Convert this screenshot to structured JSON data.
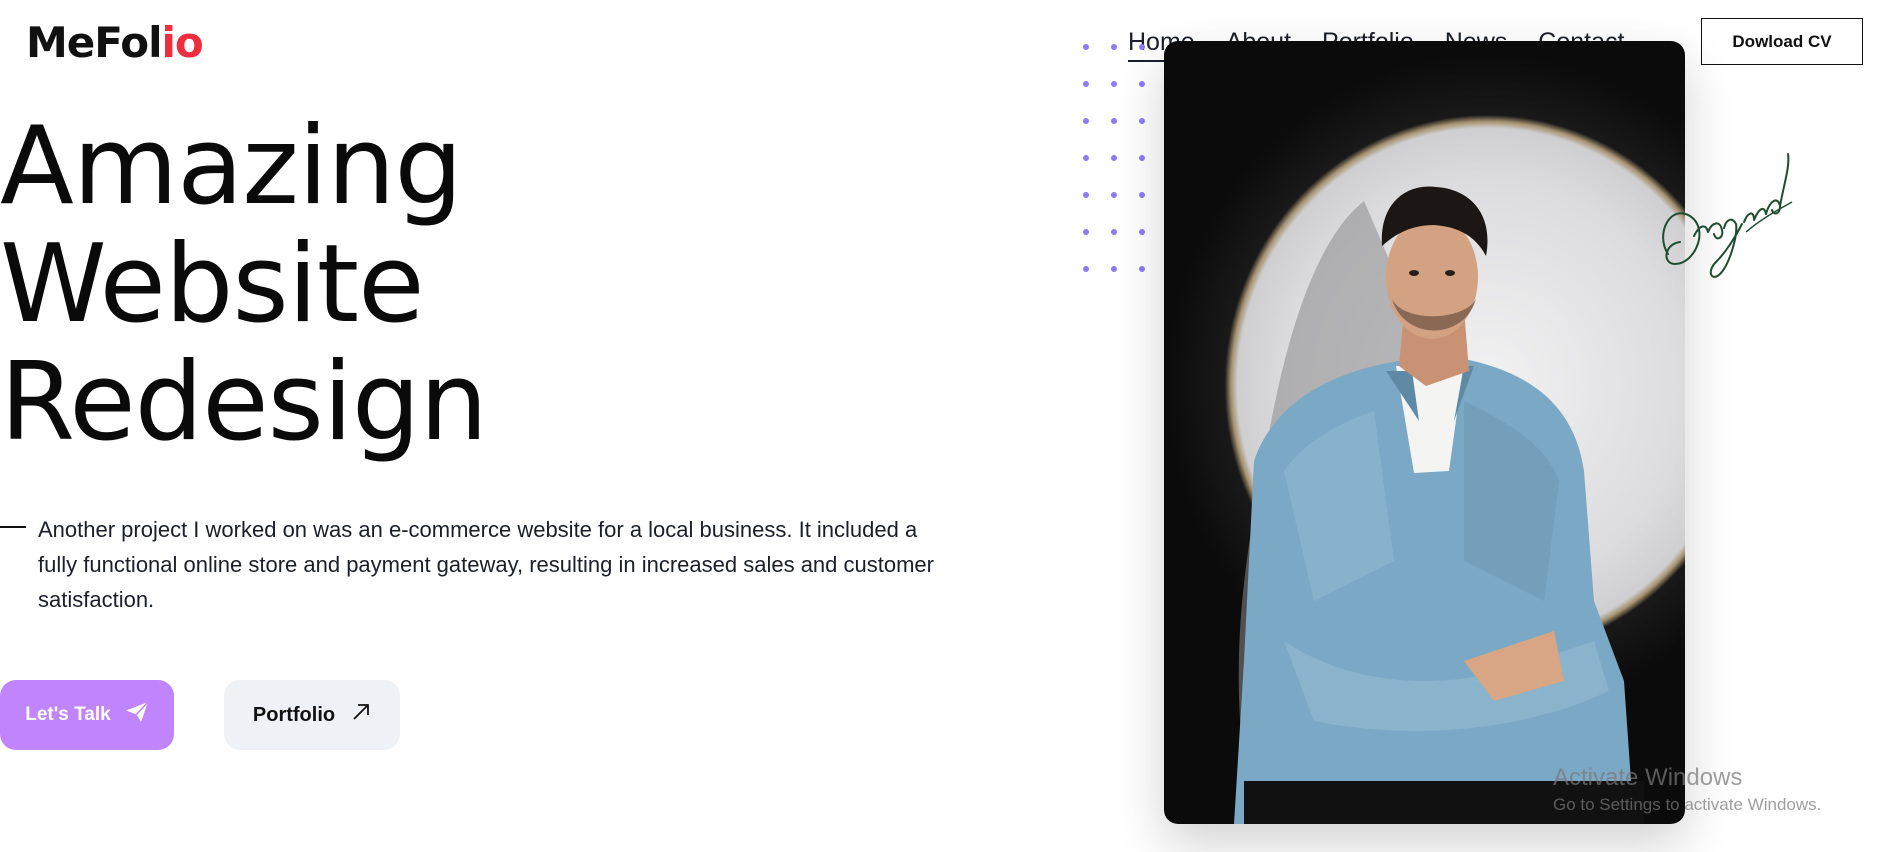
{
  "logo": {
    "part1": "MeFol",
    "part2": "io"
  },
  "nav": {
    "items": [
      {
        "label": "Home",
        "active": true
      },
      {
        "label": "About"
      },
      {
        "label": "Portfolio"
      },
      {
        "label": "News"
      },
      {
        "label": "Contact"
      }
    ],
    "cv_button": "Dowload CV"
  },
  "hero": {
    "title_lines": [
      "Amazing",
      "Website",
      "Redesign"
    ],
    "description": "Another project I worked on was an e-commerce website for a local business. It included a fully functional online store and payment gateway, resulting in increased sales and customer satisfaction.",
    "primary_button": "Let's Talk",
    "primary_icon": "paper-plane-icon",
    "secondary_button": "Portfolio",
    "secondary_icon": "arrow-up-right-icon"
  },
  "signature": "Original",
  "watermark": {
    "line1": "Activate Windows",
    "line2": "Go to Settings to activate Windows."
  },
  "colors": {
    "accent": "#c084fc",
    "logo_red": "#ef2d3f",
    "dots": "#8b7cf6",
    "button_light": "#eef2f7"
  }
}
